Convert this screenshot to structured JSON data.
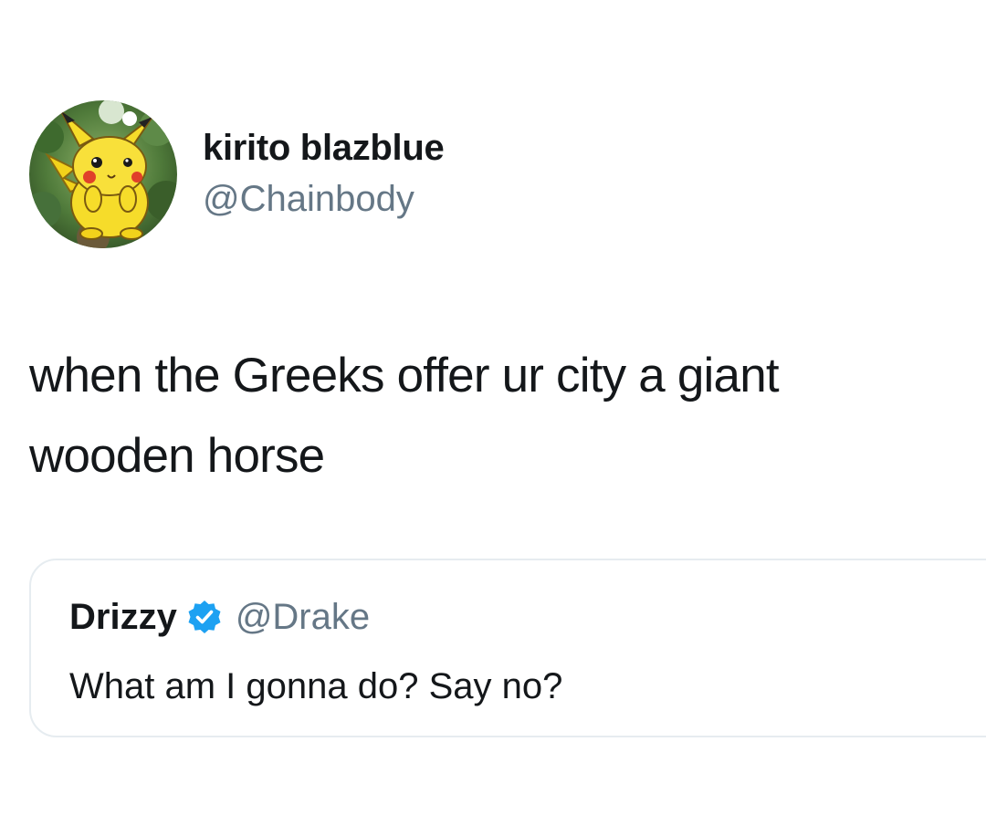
{
  "tweet": {
    "author": {
      "display_name": "kirito blazblue",
      "handle": "@Chainbody",
      "avatar_icon": "pikachu-avatar-icon"
    },
    "text": "when the Greeks offer ur city a giant\nwooden horse",
    "quoted_tweet": {
      "display_name": "Drizzy",
      "verified_icon": "verified-badge-icon",
      "handle": "@Drake",
      "text": "What am I gonna do? Say no?"
    }
  },
  "colors": {
    "text_primary": "#14171a",
    "text_secondary": "#657786",
    "verified_blue": "#1da1f2",
    "card_border": "#e6ecf0",
    "background": "#ffffff"
  }
}
